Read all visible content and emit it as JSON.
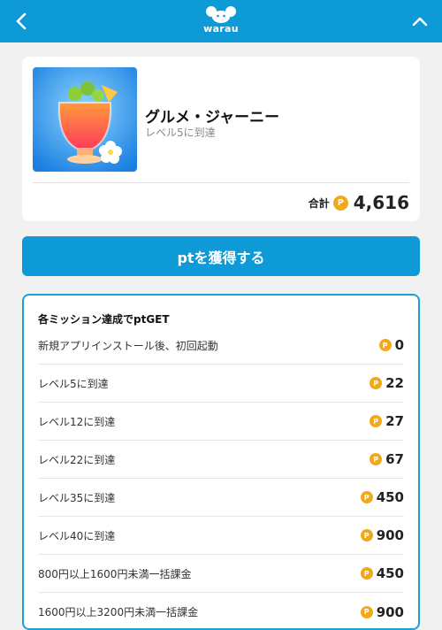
{
  "header": {
    "logo_text": "warau",
    "icons": [
      "back-arrow-icon",
      "logo-mouse-icon",
      "chevron-up-icon"
    ],
    "color": "#0d9ad6"
  },
  "app": {
    "name": "グルメ・ジャーニー",
    "subtitle": "レベル5に到達",
    "total_label": "合計",
    "total_value": "4,616",
    "coin_symbol": "P"
  },
  "cta": {
    "label": "ptを獲得する"
  },
  "missions": {
    "title": "各ミッション達成でptGET",
    "coin_symbol": "P",
    "items": [
      {
        "label": "新規アプリインストール後、初回起動",
        "points": "0"
      },
      {
        "label": "レベル5に到達",
        "points": "22"
      },
      {
        "label": "レベル12に到達",
        "points": "27"
      },
      {
        "label": "レベル22に到達",
        "points": "67"
      },
      {
        "label": "レベル35に到達",
        "points": "450"
      },
      {
        "label": "レベル40に到達",
        "points": "900"
      },
      {
        "label": "800円以上1600円未満一括課金",
        "points": "450"
      },
      {
        "label": "1600円以上3200円未満一括課金",
        "points": "900"
      }
    ]
  },
  "colors": {
    "accent": "#0d9ad6",
    "coin": "#f2a81b",
    "border": "#1aa1d8"
  }
}
